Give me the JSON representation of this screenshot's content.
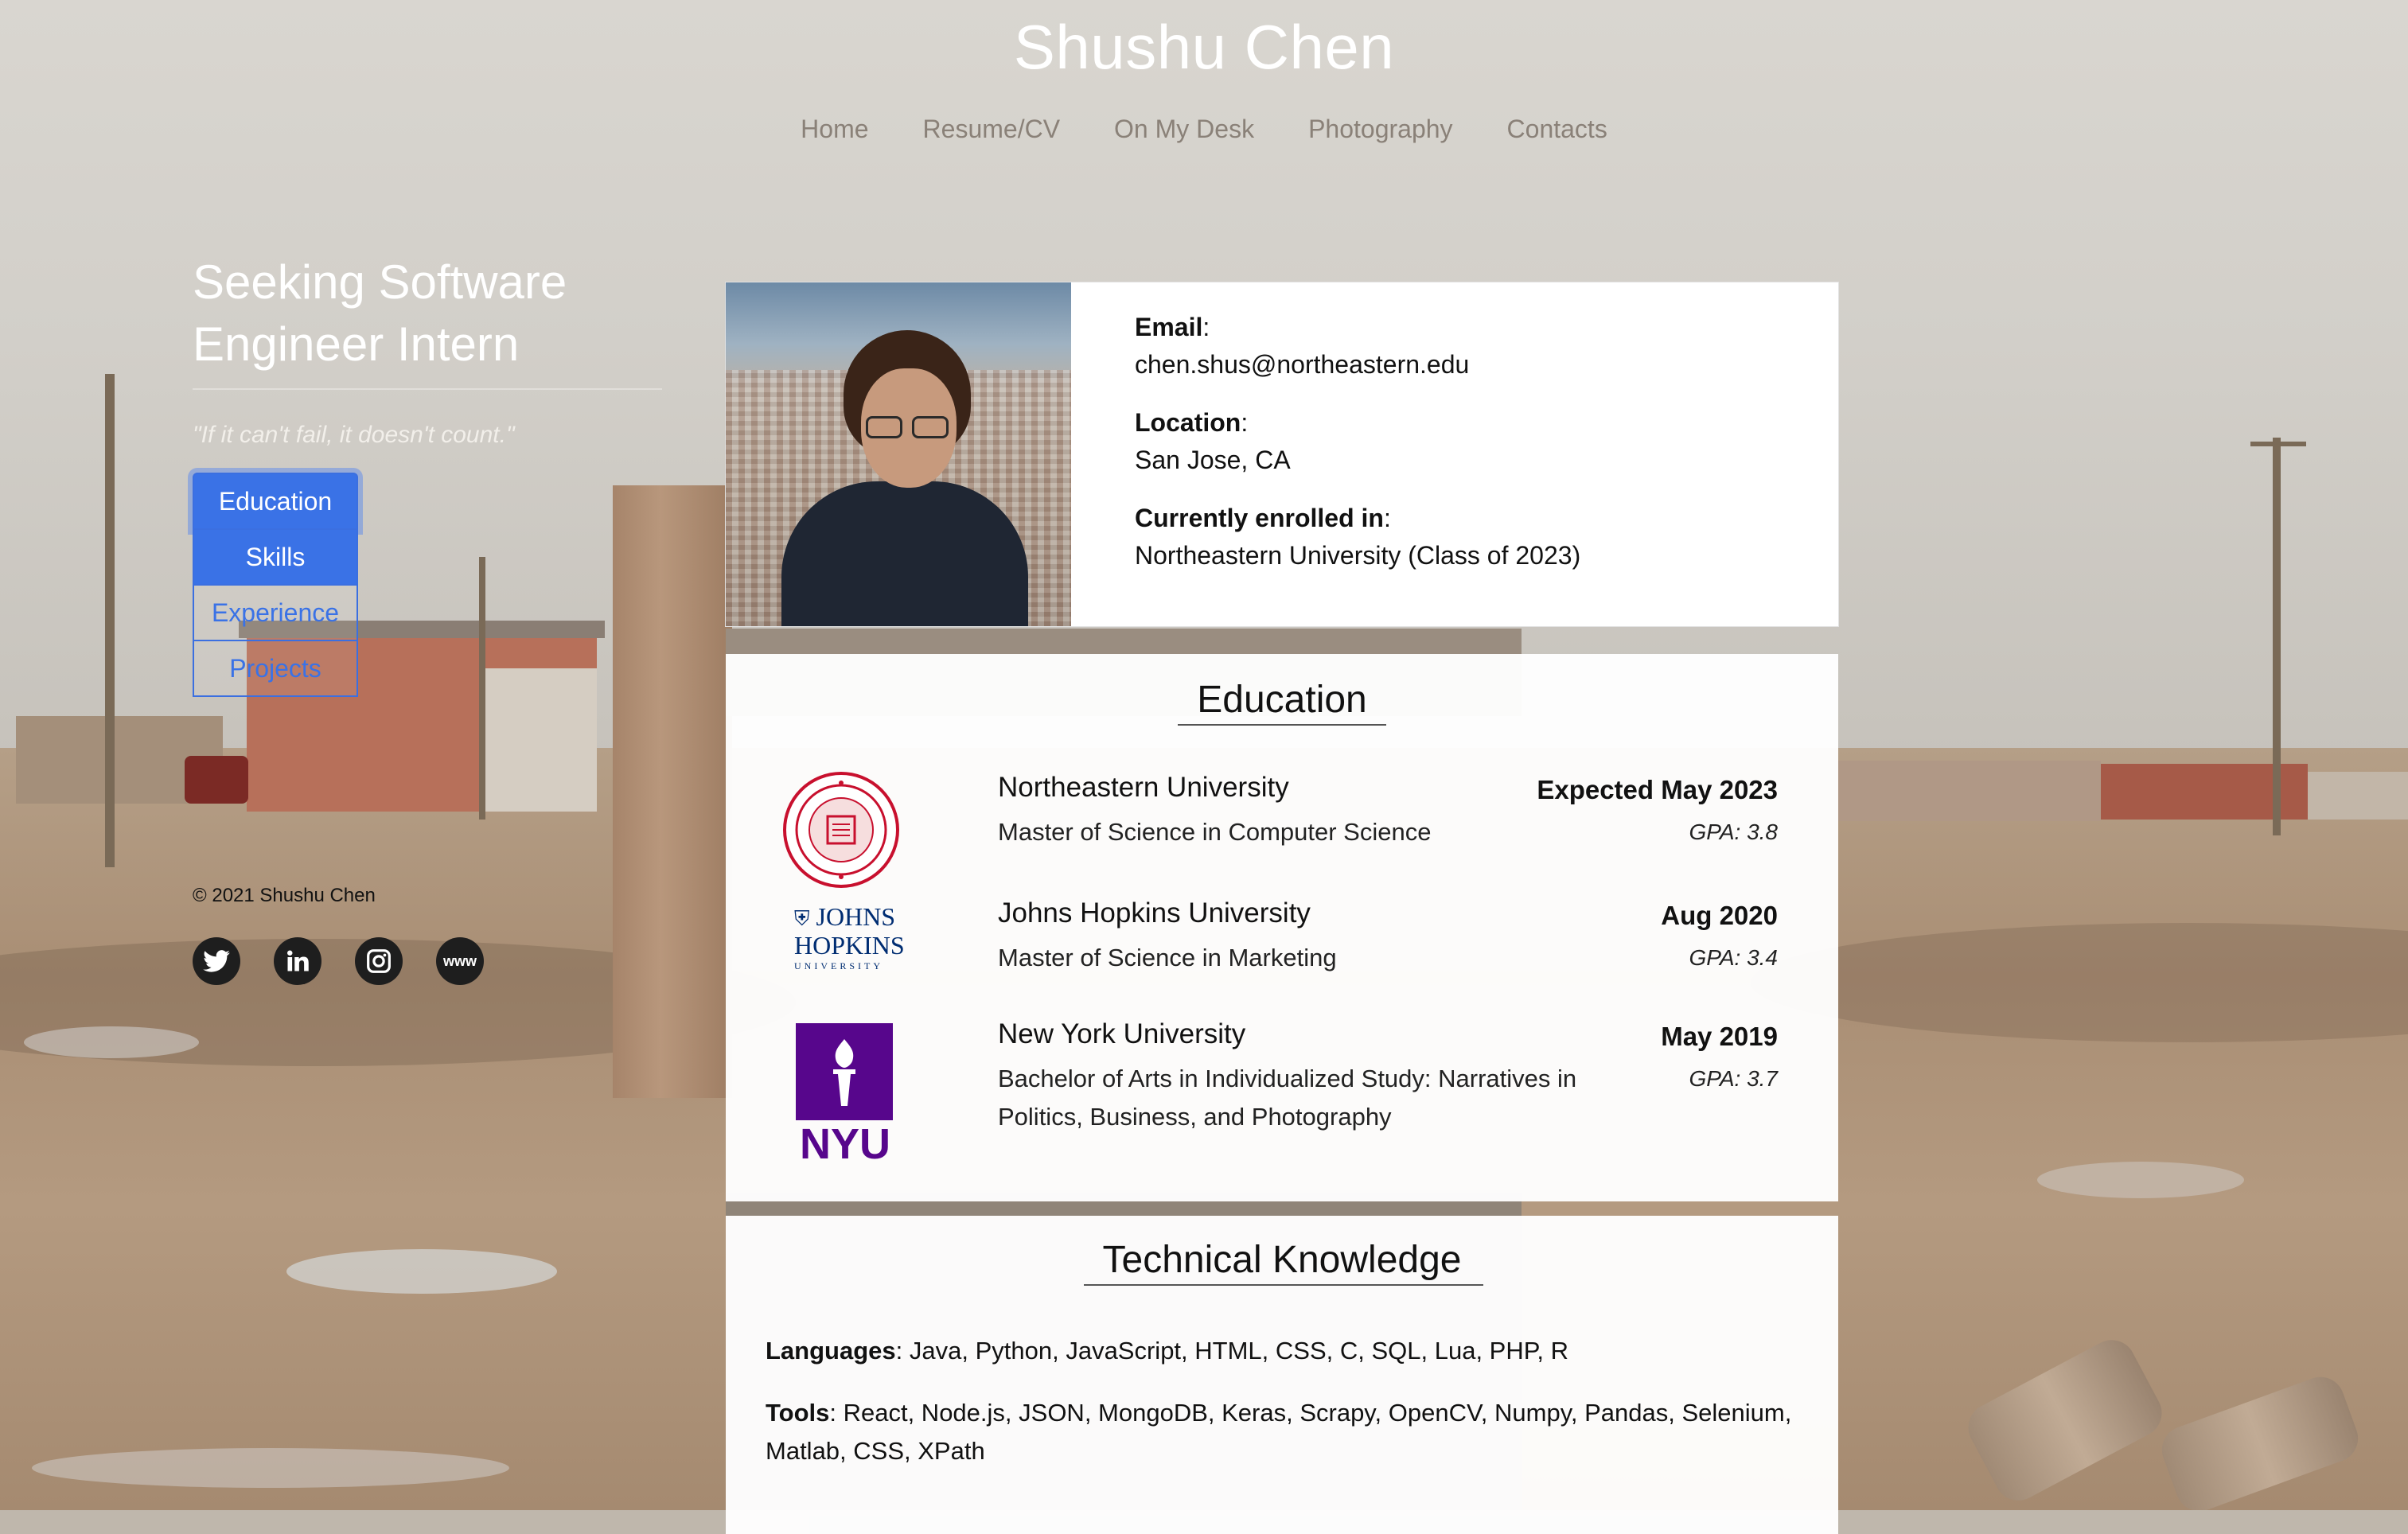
{
  "site": {
    "title": "Shushu Chen"
  },
  "nav": {
    "items": [
      "Home",
      "Resume/CV",
      "On My Desk",
      "Photography",
      "Contacts"
    ]
  },
  "sidebar": {
    "heading": "Seeking Software Engineer Intern",
    "quote": "\"If it can't fail, it doesn't count.\"",
    "menu": [
      {
        "label": "Education",
        "state": "active"
      },
      {
        "label": "Skills",
        "state": "active"
      },
      {
        "label": "Experience",
        "state": "inactive"
      },
      {
        "label": "Projects",
        "state": "inactive"
      }
    ],
    "copyright": "© 2021 Shushu Chen",
    "social": {
      "www_label": "www"
    }
  },
  "profile": {
    "email_label": "Email",
    "email": "chen.shus@northeastern.edu",
    "location_label": "Location",
    "location": "San Jose, CA",
    "enrolled_label": "Currently enrolled in",
    "enrolled": "Northeastern University (Class of 2023)"
  },
  "education": {
    "title": "Education",
    "entries": [
      {
        "school": "Northeastern University",
        "degree": "Master of Science in Computer Science",
        "date": "Expected May 2023",
        "gpa": "GPA: 3.8"
      },
      {
        "school": "Johns Hopkins University",
        "degree": "Master of Science in Marketing",
        "date": "Aug 2020",
        "gpa": "GPA: 3.4"
      },
      {
        "school": "New York University",
        "degree": "Bachelor of Arts in Individualized Study: Narratives in Politics, Business, and Photography",
        "date": "May 2019",
        "gpa": "GPA: 3.7"
      }
    ],
    "logos": {
      "jhu_line1": "JOHNS",
      "jhu_line2": "HOPKINS",
      "jhu_line3": "UNIVERSITY",
      "nyu": "NYU"
    }
  },
  "tech": {
    "title": "Technical Knowledge",
    "languages_label": "Languages",
    "languages": ": Java, Python, JavaScript, HTML, CSS, C, SQL, Lua, PHP, R",
    "tools_label": "Tools",
    "tools": ": React, Node.js, JSON, MongoDB, Keras, Scrapy, OpenCV, Numpy, Pandas, Selenium, Matlab, CSS, XPath"
  },
  "colors": {
    "accent": "#3a72e6",
    "nav_text": "#8a8178",
    "nyu_purple": "#57068c",
    "neu_red": "#c8102e",
    "jhu_navy": "#002d72"
  }
}
